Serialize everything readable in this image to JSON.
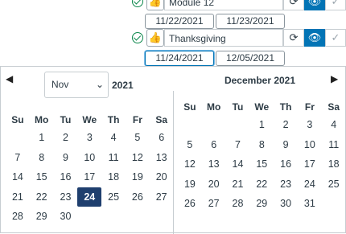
{
  "modules": [
    {
      "name": "Module 12",
      "start": "11/22/2021",
      "end": "11/23/2021"
    },
    {
      "name": "Thanksgiving",
      "start": "11/24/2021",
      "end": "12/05/2021"
    }
  ],
  "icons": {
    "check": "check-circle-icon",
    "thumb": "thumbs-up-icon",
    "sync": "refresh-icon",
    "eye": "eye-icon",
    "ok": "checkmark-icon"
  },
  "colors": {
    "accent": "#0374b5",
    "selected_day": "#1f3f6e",
    "success": "#0b874b"
  },
  "calendar": {
    "left": {
      "month_select": "Nov",
      "year": "2021",
      "weekdays": [
        "Su",
        "Mo",
        "Tu",
        "We",
        "Th",
        "Fr",
        "Sa"
      ],
      "weeks": [
        [
          "",
          "1",
          "2",
          "3",
          "4",
          "5",
          "6"
        ],
        [
          "7",
          "8",
          "9",
          "10",
          "11",
          "12",
          "13"
        ],
        [
          "14",
          "15",
          "16",
          "17",
          "18",
          "19",
          "20"
        ],
        [
          "21",
          "22",
          "23",
          "24",
          "25",
          "26",
          "27"
        ],
        [
          "28",
          "29",
          "30",
          "",
          "",
          "",
          ""
        ]
      ],
      "selected": "24"
    },
    "right": {
      "title": "December 2021",
      "weekdays": [
        "Su",
        "Mo",
        "Tu",
        "We",
        "Th",
        "Fr",
        "Sa"
      ],
      "weeks": [
        [
          "",
          "",
          "",
          "1",
          "2",
          "3",
          "4"
        ],
        [
          "5",
          "6",
          "7",
          "8",
          "9",
          "10",
          "11"
        ],
        [
          "12",
          "13",
          "14",
          "15",
          "16",
          "17",
          "18"
        ],
        [
          "19",
          "20",
          "21",
          "22",
          "23",
          "24",
          "25"
        ],
        [
          "26",
          "27",
          "28",
          "29",
          "30",
          "31",
          ""
        ]
      ]
    }
  }
}
